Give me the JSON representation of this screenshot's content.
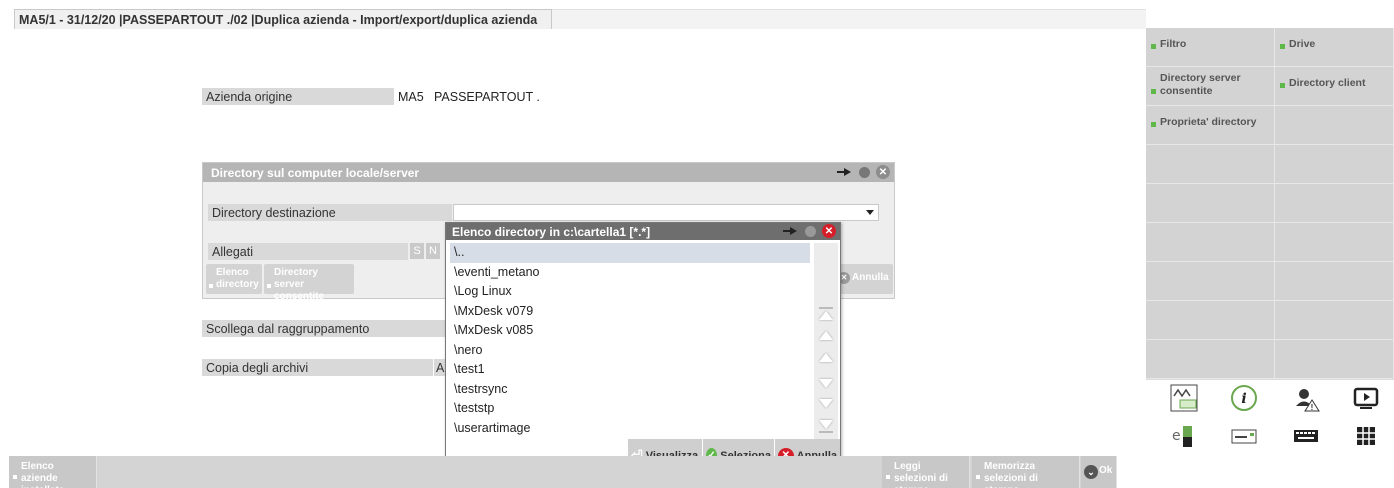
{
  "title": "MA5/1 - 31/12/20 |PASSEPARTOUT ./02 |Duplica  azienda - Import/export/duplica azienda",
  "form": {
    "azienda_label": "Azienda origine",
    "azienda_code": "MA5",
    "azienda_name": "PASSEPARTOUT .",
    "scollega_label": "Scollega dal raggruppamento",
    "copia_label": "Copia degli archivi",
    "copia_value": "A"
  },
  "dir_panel": {
    "title": "Directory sul computer locale/server",
    "dest_label": "Directory destinazione",
    "dest_value": "",
    "allegati_label": "Allegati",
    "s": "S",
    "n": "N",
    "btn_elenco": "Elenco directory",
    "btn_server": "Directory server consentite",
    "btn_annulla": "Annulla"
  },
  "list_popup": {
    "title": "Elenco directory in c:\\cartella1 [*.*]",
    "items": [
      "\\..",
      "\\eventi_metano",
      "\\Log Linux",
      "\\MxDesk v079",
      "\\MxDesk v085",
      "\\nero",
      "\\test1",
      "\\testrsync",
      "\\teststp",
      "\\userartimage"
    ],
    "selected_index": 0,
    "btn_visualizza": "Visualizza",
    "btn_seleziona": "Seleziona",
    "btn_annulla": "Annulla"
  },
  "right_panel": {
    "filtro": "Filtro",
    "drive": "Drive",
    "dir_server": "Directory server consentite",
    "dir_client": "Directory client",
    "proprieta": "Proprieta' directory"
  },
  "bottom": {
    "elenco_aziende": "Elenco aziende installate",
    "leggi": "Leggi selezioni di stampa",
    "memorizza": "Memorizza selezioni di stampa",
    "ok": "Ok"
  },
  "colors": {
    "accent_green": "#5fb84a",
    "close_red": "#d61e2a"
  }
}
